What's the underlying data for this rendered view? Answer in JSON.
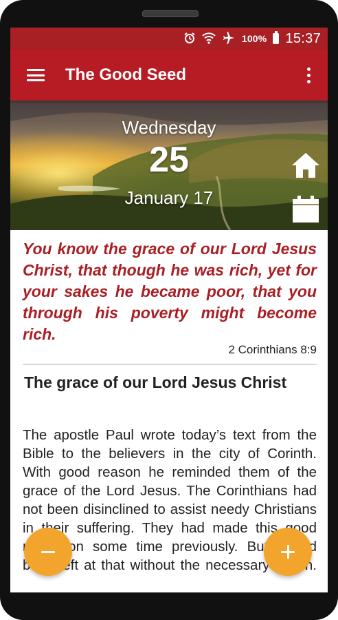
{
  "status_bar": {
    "icons": [
      "alarm-icon",
      "wifi-icon",
      "airplane-icon",
      "battery-icon"
    ],
    "battery": "100%",
    "time": "15:37"
  },
  "app_bar": {
    "title": "The Good Seed",
    "menu_icon": "hamburger-menu-icon",
    "overflow_icon": "more-vert-icon"
  },
  "date": {
    "weekday": "Wednesday",
    "day": "25",
    "month_year": "January 17",
    "home_icon": "home-icon",
    "calendar_icon": "calendar-icon"
  },
  "verse": {
    "text": "You know the grace of our Lord Jesus Christ, that though he was rich, yet for your sakes he became poor, that you through his poverty might become rich.",
    "reference": "2 Corinthians 8:9"
  },
  "article": {
    "title": "The grace of our Lord Jesus Christ",
    "body": "The apostle Paul wrote today’s text from the Bible to the believers in the city of Corinth. With good reason he reminded them of the grace of the Lord Jesus. The Corinthians had not been disinclined to assist needy Christians in their suffering. They had made this good resolution some time previously. But it had been left at that without the necessary action."
  },
  "actions": {
    "decrease_icon": "minus-icon",
    "increase_icon": "plus-icon"
  },
  "colors": {
    "primary": "#b71c24",
    "status_bar": "#a81f24",
    "verse_text": "#a81f24",
    "fab": "#f3a42c"
  }
}
